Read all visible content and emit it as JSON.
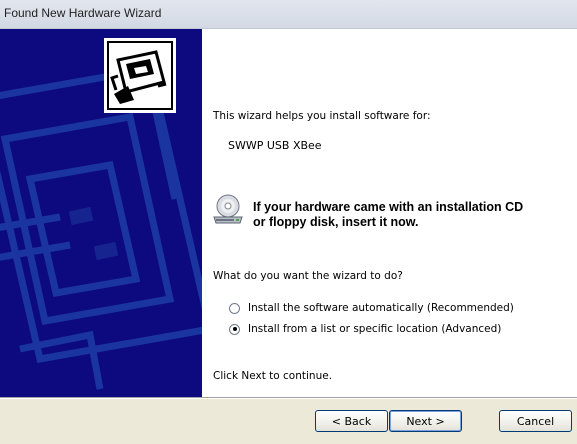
{
  "window": {
    "title": "Found New Hardware Wizard"
  },
  "content": {
    "intro": "This wizard helps you install software for:",
    "device_name": "SWWP USB XBee",
    "cd_notice_line1": "If your hardware came with an installation CD",
    "cd_notice_line2": "or floppy disk, insert it now.",
    "question": "What do you want the wizard to do?",
    "options": [
      {
        "label": "Install the software automatically (Recommended)",
        "selected": false
      },
      {
        "label": "Install from a list or specific location (Advanced)",
        "selected": true
      }
    ],
    "footer": "Click Next to continue."
  },
  "buttons": {
    "back": "< Back",
    "next": "Next >",
    "cancel": "Cancel"
  },
  "colors": {
    "sidepanel": "#0d0a80",
    "buttonbar": "#ece9d8",
    "button_border": "#003c74"
  },
  "icons": {
    "wizard": "hardware-card-icon",
    "cd": "cd-drive-icon"
  }
}
